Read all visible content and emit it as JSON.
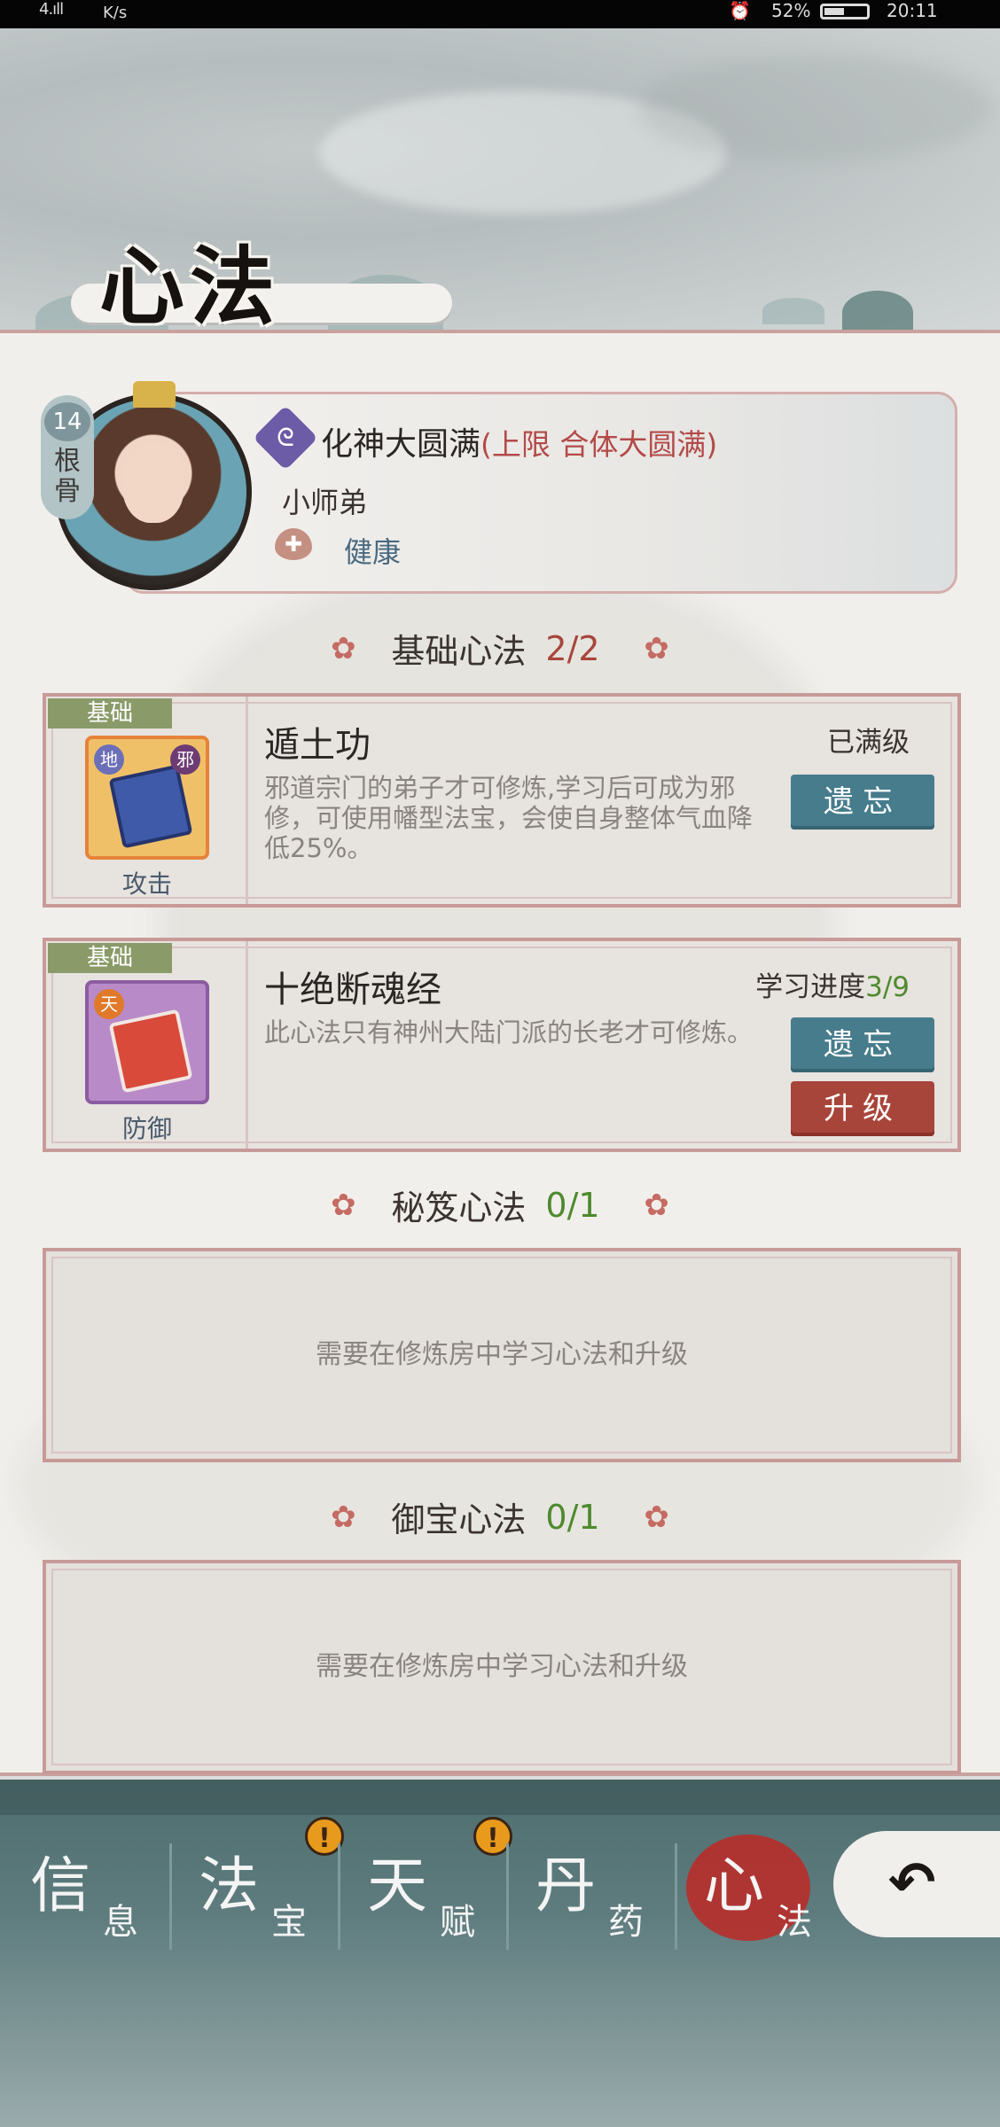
{
  "status_bar": {
    "signal": "4.ıll",
    "speed": "K/s",
    "battery": "52%",
    "time": "20:11"
  },
  "page": {
    "title": "心法"
  },
  "character": {
    "root_bone_value": "14",
    "root_bone_label": "根骨",
    "realm": "化神大圆满",
    "realm_limit": "(上限 合体大圆满)",
    "name": "小师弟",
    "health_status": "健康"
  },
  "sections": {
    "basic": {
      "name": "基础心法",
      "count": "2/2",
      "count_color": "#a8453a"
    },
    "secret": {
      "name": "秘笈心法",
      "count": "0/1",
      "count_color": "#4f8a2e"
    },
    "treasure": {
      "name": "御宝心法",
      "count": "0/1",
      "count_color": "#4f8a2e"
    }
  },
  "techniques": [
    {
      "tag": "基础",
      "name": "遁土功",
      "type": "攻击",
      "status": "已满级",
      "description": "邪道宗门的弟子才可修炼,学习后可成为邪修，可使用幡型法宝，会使自身整体气血降低25%。",
      "badge1": "地",
      "badge2": "邪",
      "forget_label": "遗忘"
    },
    {
      "tag": "基础",
      "name": "十绝断魂经",
      "type": "防御",
      "status_label": "学习进度",
      "progress": "3/9",
      "description": "此心法只有神州大陆门派的长老才可修炼。",
      "badge1": "天",
      "forget_label": "遗忘",
      "upgrade_label": "升级"
    }
  ],
  "empty_slots": {
    "secret_hint": "需要在修炼房中学习心法和升级",
    "treasure_hint": "需要在修炼房中学习心法和升级"
  },
  "nav": {
    "items": [
      {
        "big": "信",
        "small": "息"
      },
      {
        "big": "法",
        "small": "宝",
        "alert": "!"
      },
      {
        "big": "天",
        "small": "赋",
        "alert": "!"
      },
      {
        "big": "丹",
        "small": "药"
      },
      {
        "big": "心",
        "small": "法"
      }
    ],
    "active": "心法",
    "back_icon": "back-arrow-icon"
  }
}
